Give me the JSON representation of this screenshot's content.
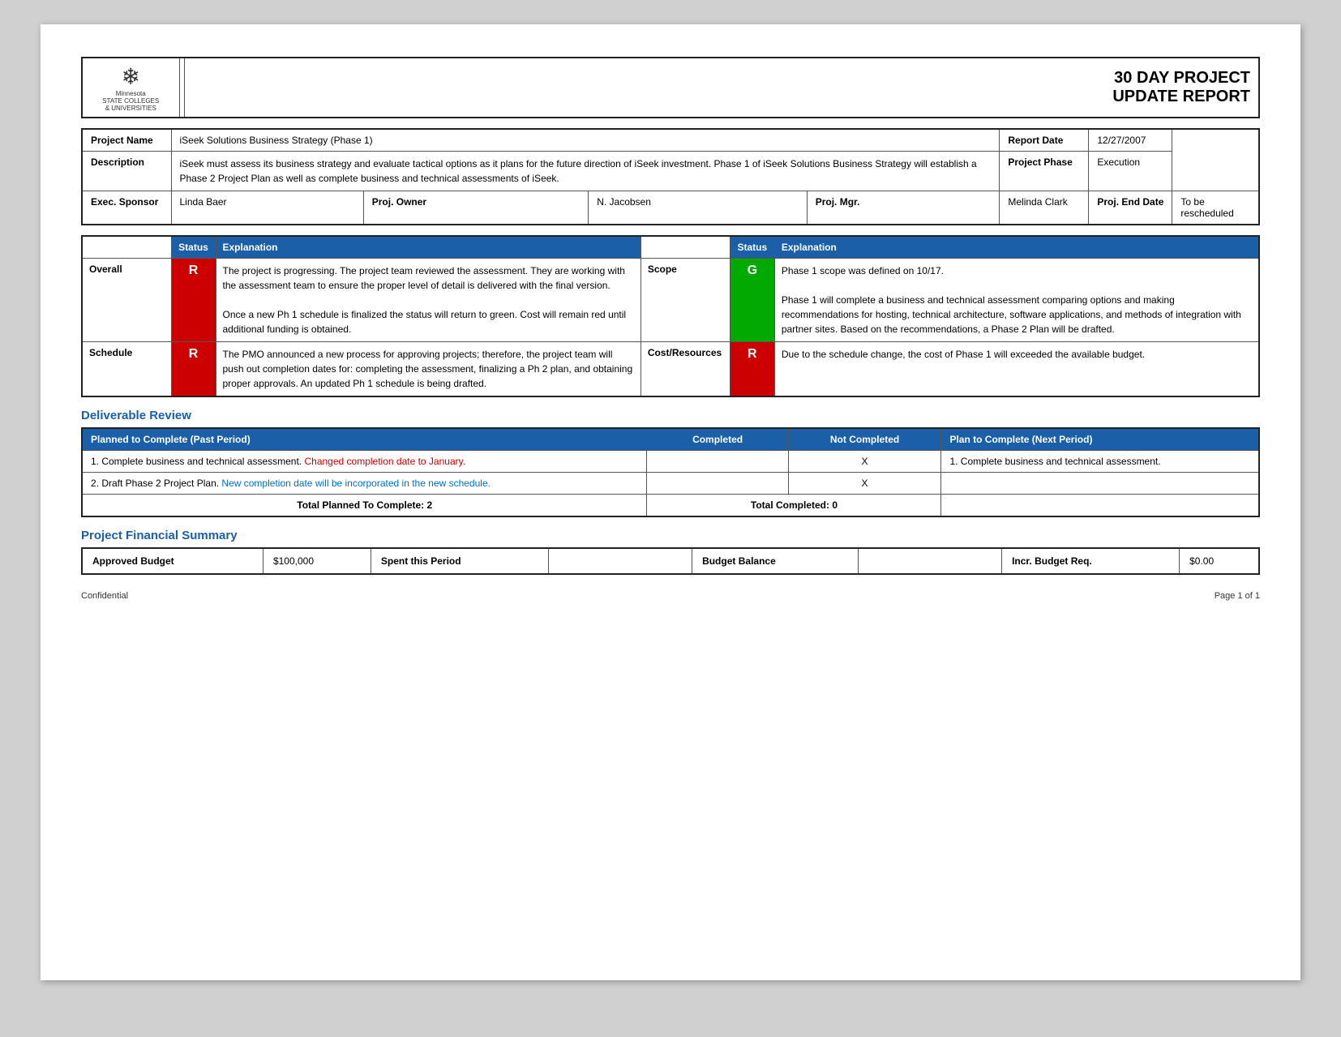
{
  "report": {
    "title_line1": "30 DAY PROJECT",
    "title_line2": "UPDATE REPORT"
  },
  "logo": {
    "snowflake": "❄",
    "line1": "Minnesota",
    "line2": "STATE COLLEGES",
    "line3": "& UNIVERSITIES"
  },
  "project_info": {
    "project_name_label": "Project Name",
    "project_name_value": "iSeek Solutions Business Strategy (Phase 1)",
    "report_date_label": "Report Date",
    "report_date_value": "12/27/2007",
    "description_label": "Description",
    "description_value": "iSeek must assess its business strategy and evaluate tactical options as it plans for the future direction of iSeek investment.  Phase 1 of iSeek Solutions Business Strategy will establish a Phase 2 Project Plan as well as complete business and technical assessments of iSeek.",
    "project_phase_label": "Project Phase",
    "project_phase_value": "Execution",
    "exec_sponsor_label": "Exec. Sponsor",
    "exec_sponsor_value": "Linda Baer",
    "proj_owner_label": "Proj. Owner",
    "proj_owner_value": "N. Jacobsen",
    "proj_mgr_label": "Proj. Mgr.",
    "proj_mgr_value": "Melinda Clark",
    "proj_end_date_label": "Proj. End Date",
    "proj_end_date_value": "To be rescheduled"
  },
  "status_section": {
    "col1_header_status": "Status",
    "col1_header_explanation": "Explanation",
    "col2_header_status": "Status",
    "col2_header_explanation": "Explanation",
    "rows": [
      {
        "left_label": "Overall",
        "left_status": "R",
        "left_explanation": "The project is progressing.  The project team reviewed the assessment.  They are working with the assessment team to ensure the proper level of detail is delivered with the final version.\n\nOnce a new Ph 1 schedule is finalized the status will return to green.  Cost will remain red until additional funding is obtained.",
        "right_label": "Scope",
        "right_status": "G",
        "right_explanation": "Phase 1 scope was defined on 10/17.\n\nPhase 1 will complete a business and technical assessment comparing options and making recommendations for hosting, technical architecture, software applications, and methods of integration with partner sites. Based on the recommendations, a Phase 2 Plan will be drafted."
      },
      {
        "left_label": "Schedule",
        "left_status": "R",
        "left_explanation": "The PMO announced a new process for approving projects; therefore, the project team will push out completion dates for:  completing the assessment, finalizing a Ph 2 plan, and obtaining proper approvals. An updated Ph 1 schedule is being drafted.",
        "right_label": "Cost/Resources",
        "right_status": "R",
        "right_explanation": "Due to the schedule change, the cost of Phase 1 will exceeded the available budget."
      }
    ]
  },
  "deliverable_review": {
    "section_title": "Deliverable Review",
    "col_planned": "Planned to Complete (Past Period)",
    "col_completed": "Completed",
    "col_not_completed": "Not Completed",
    "col_next": "Plan to Complete (Next Period)",
    "items": [
      {
        "number": "1.",
        "text_before_change": "Complete business and technical assessment.",
        "changed_text": "Changed completion date to January.",
        "completed": "",
        "not_completed": "X",
        "next_period": "1.  Complete business and technical assessment."
      },
      {
        "number": "2.",
        "text_before_change": "Draft Phase 2 Project Plan.",
        "changed_text": "New completion date will be incorporated in the new schedule.",
        "completed": "",
        "not_completed": "X",
        "next_period": ""
      }
    ],
    "footer_left": "Total Planned To Complete: 2",
    "footer_center": "Total Completed: 0"
  },
  "financial_summary": {
    "section_title": "Project Financial Summary",
    "approved_budget_label": "Approved Budget",
    "approved_budget_value": "$100,000",
    "spent_label": "Spent this Period",
    "spent_value": "",
    "budget_balance_label": "Budget Balance",
    "budget_balance_value": "",
    "incr_budget_label": "Incr. Budget Req.",
    "incr_budget_value": "$0.00"
  },
  "footer": {
    "confidential": "Confidential",
    "page": "Page 1 of 1"
  }
}
